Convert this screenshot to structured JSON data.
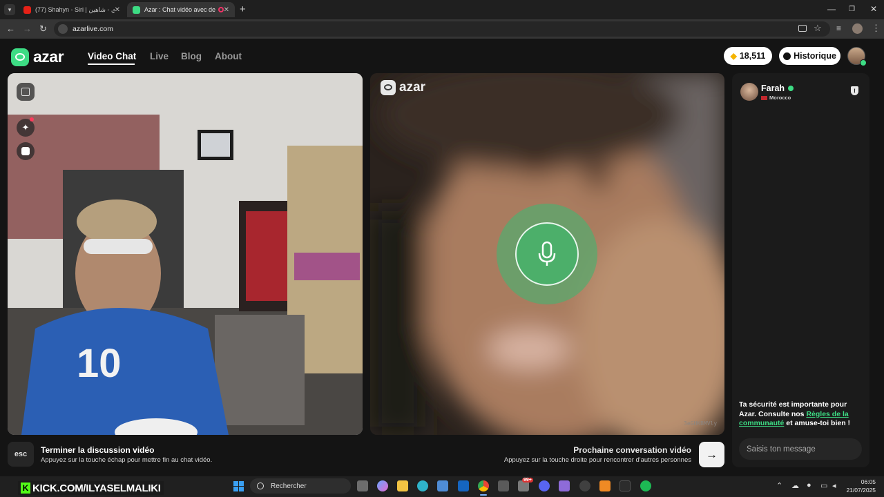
{
  "browser": {
    "tabs": [
      {
        "label": "(77) Shahyn - Siri | سيري - شاهين"
      },
      {
        "label": "Azar : Chat vidéo avec de n"
      }
    ],
    "new_tab": "+",
    "url": "azarlive.com"
  },
  "site": {
    "logo": "azar",
    "nav": [
      "Video Chat",
      "Live",
      "Blog",
      "About"
    ],
    "gems": "18,511",
    "history_label": "Historique"
  },
  "video": {
    "remote_logo": "azar",
    "watermark": "3eGHKBMVly"
  },
  "chat": {
    "user_name": "Farah",
    "country": "Morocco",
    "safety_pre": "Ta sécurité est importante pour Azar. Consulte nos ",
    "safety_link": "Règles de la communauté",
    "safety_post": " et amuse-toi bien !",
    "input_placeholder": "Saisis ton message"
  },
  "controls": {
    "esc_key": "esc",
    "end_title": "Terminer la discussion vidéo",
    "end_desc": "Appuyez sur la touche échap pour mettre fin au chat vidéo.",
    "next_title": "Prochaine conversation vidéo",
    "next_desc": "Appuyez sur la touche droite pour rencontrer d'autres personnes"
  },
  "overlay": {
    "banner": "KICK.COM/ILYASELMALIKI"
  },
  "taskbar": {
    "search_label": "Rechercher",
    "badge": "99+",
    "time": "06:05",
    "date": "21/07/2025"
  }
}
